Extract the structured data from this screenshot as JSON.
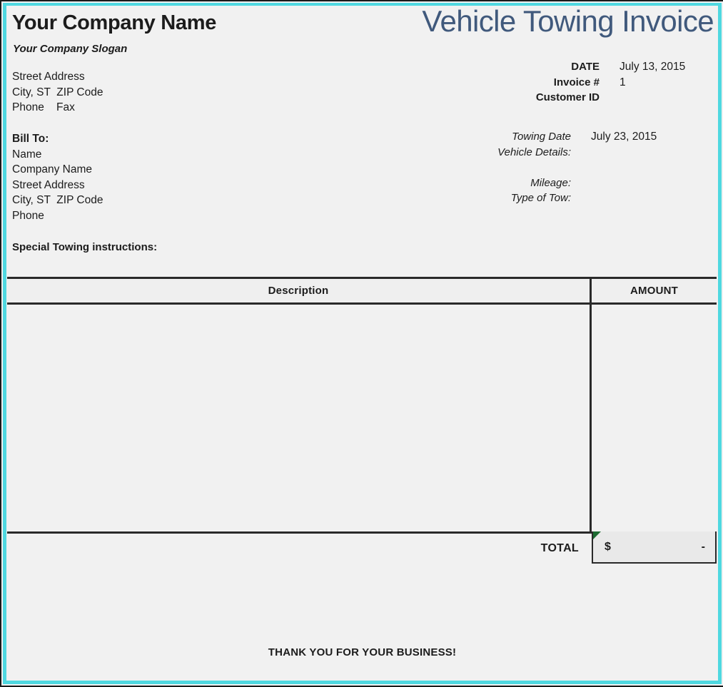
{
  "document": {
    "title": "Vehicle Towing Invoice",
    "title_color": "#40597c",
    "frame_color": "#4fd8e0",
    "comment_marker_color": "#1d6b32"
  },
  "company": {
    "name": "Your Company Name",
    "slogan": "Your Company Slogan",
    "address_block": "Street Address\nCity, ST  ZIP Code\nPhone    Fax"
  },
  "meta": {
    "rows": [
      {
        "label": "DATE",
        "value": "July 13, 2015"
      },
      {
        "label": "Invoice #",
        "value": "1"
      },
      {
        "label": "Customer ID",
        "value": ""
      }
    ]
  },
  "bill_to": {
    "heading": "Bill To:",
    "lines_block": "Name\nCompany Name\nStreet Address\nCity, ST  ZIP Code\nPhone"
  },
  "towing_details": {
    "rows": [
      {
        "label": "Towing Date",
        "value": "July 23, 2015"
      },
      {
        "label": "Vehicle Details:",
        "value": ""
      },
      {
        "label": "",
        "value": ""
      },
      {
        "label": "Mileage:",
        "value": ""
      },
      {
        "label": "Type of Tow:",
        "value": ""
      }
    ]
  },
  "special_instructions": {
    "label": "Special Towing instructions:",
    "value": ""
  },
  "items_table": {
    "columns": [
      "Description",
      "AMOUNT"
    ],
    "rows": []
  },
  "total": {
    "label": "TOTAL",
    "currency": "$",
    "amount": "-"
  },
  "footer": {
    "message": "THANK YOU FOR YOUR BUSINESS!"
  }
}
